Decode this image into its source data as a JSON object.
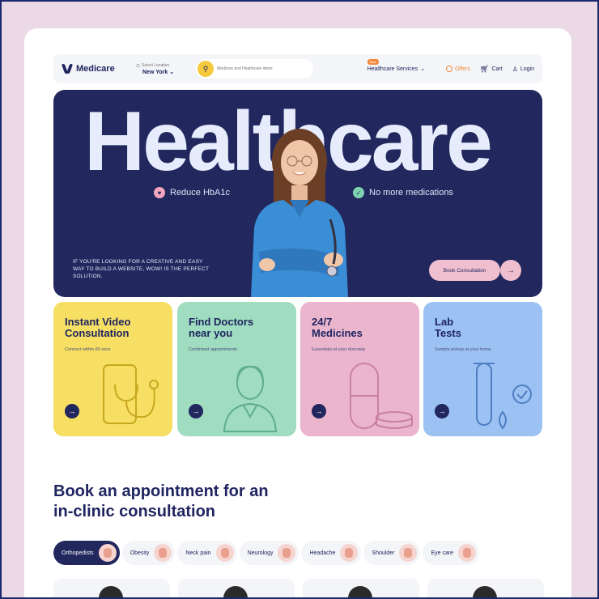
{
  "nav": {
    "brand": "Medicare",
    "location_label": "Select Location",
    "location_value": "New York",
    "search_placeholder": "Medicine and Healthcare items",
    "services_badge": "New",
    "services_label": "Healthcare Services",
    "offers_label": "Offers",
    "cart_label": "Cart",
    "login_label": "Login"
  },
  "hero": {
    "title": "Healthcare",
    "bullets": [
      {
        "label": "Reduce HbA1c",
        "icon": "heart-icon",
        "color": "#f2a6bd"
      },
      {
        "label": "No more medications",
        "icon": "check-icon",
        "color": "#7dd3b0"
      }
    ],
    "copy": "IF YOU'RE LOOKING FOR A CREATIVE AND EASY WAY TO BUILD A WEBSITE, WOW! IS THE PERFECT SOLUTION.",
    "cta_label": "Book Consultation",
    "bg_color": "#22275e"
  },
  "services": [
    {
      "title_line1": "Instant Video",
      "title_line2": "Consultation",
      "subtitle": "Connect within 60 secs",
      "color": "#f6df63",
      "icon": "phone-stethoscope-icon"
    },
    {
      "title_line1": "Find Doctors",
      "title_line2": "near you",
      "subtitle": "Confirmed appointments",
      "color": "#9fdcc0",
      "icon": "doctor-icon"
    },
    {
      "title_line1": "24/7",
      "title_line2": "Medicines",
      "subtitle": "Essentials at your doorstep",
      "color": "#ebb6cd",
      "icon": "pill-icon"
    },
    {
      "title_line1": "Lab",
      "title_line2": "Tests",
      "subtitle": "Sample pickup at your home",
      "color": "#9cc2f3",
      "icon": "test-tube-icon"
    }
  ],
  "booking": {
    "title_line1": "Book an appointment for an",
    "title_line2": "in-clinic consultation",
    "chips": [
      "Orthopedists",
      "Obesity",
      "Neck pain",
      "Neurology",
      "Headache",
      "Shoulder",
      "Eye care"
    ]
  }
}
